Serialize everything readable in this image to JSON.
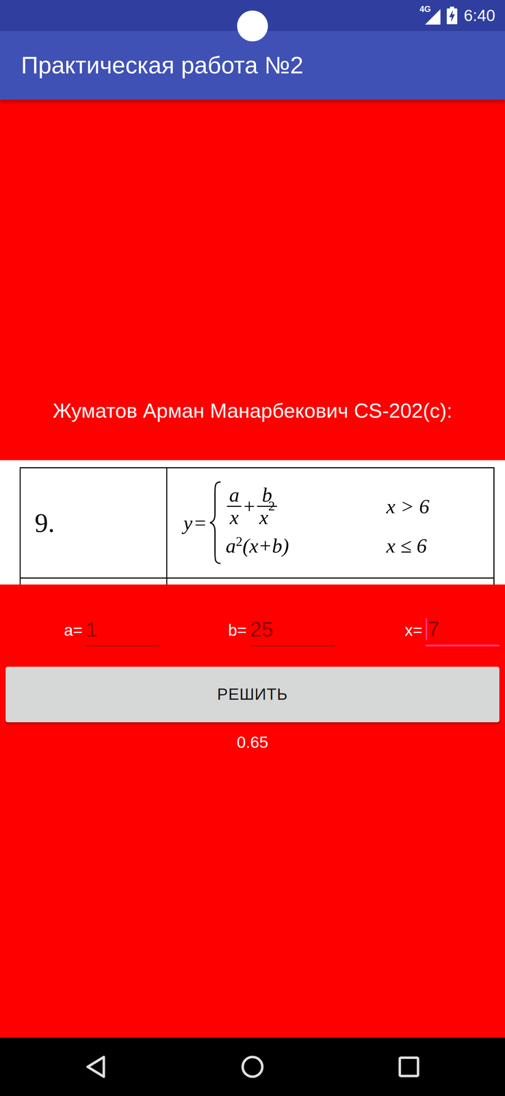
{
  "status_bar": {
    "network": "4G",
    "time": "6:40",
    "battery_charging": true
  },
  "app_bar": {
    "title": "Практическая работа №2"
  },
  "student": "Жуматов Арман Манарбекович CS-202(c):",
  "task": {
    "number": "9.",
    "lhs": "y",
    "equals": "=",
    "cases": [
      {
        "kind": "fraction_sum",
        "terms": [
          {
            "num": "a",
            "den": "x",
            "den_power": ""
          },
          {
            "num": "b",
            "den": "x",
            "den_power": "2"
          }
        ],
        "op": "+",
        "condition": "x > 6"
      },
      {
        "kind": "product",
        "base": "a",
        "power": "2",
        "rest": "(x+b)",
        "condition": "x ≤ 6"
      }
    ]
  },
  "fields": [
    {
      "label": "a=",
      "value": "1",
      "focused": false
    },
    {
      "label": "b=",
      "value": "25",
      "focused": false
    },
    {
      "label": "x=",
      "value": "7",
      "focused": true
    }
  ],
  "button": "РЕШИТЬ",
  "result": "0.65"
}
